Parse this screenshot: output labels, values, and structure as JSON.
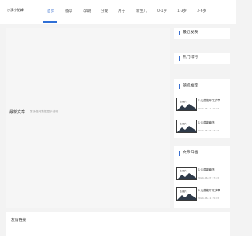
{
  "header": {
    "logo_text": "沙漠小驼峰",
    "nav": [
      "首页",
      "备孕",
      "孕期",
      "分娩",
      "月子",
      "新生儿",
      "0-1岁",
      "1-3岁",
      "3-6岁"
    ],
    "active_index": 0
  },
  "main": {
    "latest_title": "最新文章",
    "latest_note": "暂无任何数据显示说明"
  },
  "sidebar": {
    "recent_title": "最近发表",
    "hot_title": "热门排行",
    "random_title": "随机推荐",
    "random_items": [
      {
        "thumb_label": "暂无图片",
        "title": "少儿潜能开发文章",
        "date": "2024-06-11 15:03"
      },
      {
        "thumb_label": "暂无图片",
        "title": "少儿潜能篇第",
        "date": "2024-06-07 17:23"
      }
    ],
    "related_title": "文章归档",
    "related_items": [
      {
        "thumb_label": "暂无图片",
        "title": "少儿潜能篇第",
        "date": "2024-06-07 17:23"
      },
      {
        "thumb_label": "暂无图片",
        "title": "少儿潜能开发文章",
        "date": "2024-06-11 15:03"
      }
    ]
  },
  "footer": {
    "links_title": "友情链接"
  }
}
